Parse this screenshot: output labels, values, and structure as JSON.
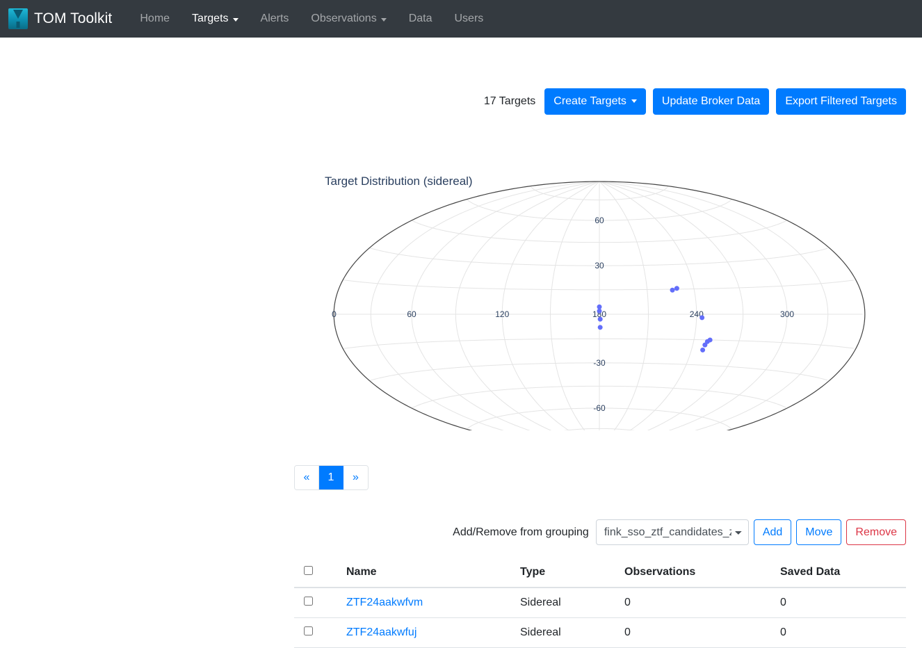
{
  "navbar": {
    "brand": "TOM Toolkit",
    "logo_icon": "tom-toolkit-logo-icon",
    "items": [
      {
        "label": "Home",
        "active": false,
        "caret": false
      },
      {
        "label": "Targets",
        "active": true,
        "caret": true
      },
      {
        "label": "Alerts",
        "active": false,
        "caret": false
      },
      {
        "label": "Observations",
        "active": false,
        "caret": true
      },
      {
        "label": "Data",
        "active": false,
        "caret": false
      },
      {
        "label": "Users",
        "active": false,
        "caret": false
      }
    ],
    "bg_color": "#343a40"
  },
  "actionbar": {
    "targets_count": "17 Targets",
    "create_targets": "Create Targets",
    "update_broker_data": "Update Broker Data",
    "export_filtered_targets": "Export Filtered Targets",
    "primary_color": "#007bff"
  },
  "chart_data": {
    "type": "scatter",
    "projection": "aitoff",
    "title": "Target Distribution (sidereal)",
    "xlabel": "",
    "ylabel": "",
    "xlim": [
      0,
      360
    ],
    "ylim": [
      -90,
      90
    ],
    "grid": true,
    "legend": "none",
    "marker_color": "#636efa",
    "marker_size": 6,
    "xticks": [
      0,
      60,
      120,
      180,
      240,
      300
    ],
    "yticks": [
      -60,
      -30,
      30,
      60
    ],
    "ra_grid_step": 30,
    "dec_grid_step": 15,
    "points": [
      {
        "ra": 180.0,
        "dec": 4.5
      },
      {
        "ra": 180.0,
        "dec": 2.0
      },
      {
        "ra": 180.5,
        "dec": -3.0
      },
      {
        "ra": 180.5,
        "dec": -8.0
      },
      {
        "ra": 226.0,
        "dec": 14.5
      },
      {
        "ra": 229.0,
        "dec": 15.5
      },
      {
        "ra": 243.5,
        "dec": -2.0
      },
      {
        "ra": 249.0,
        "dec": -16.0
      },
      {
        "ra": 250.5,
        "dec": -15.0
      },
      {
        "ra": 248.0,
        "dec": -18.0
      },
      {
        "ra": 247.5,
        "dec": -21.0
      }
    ]
  },
  "pagination": {
    "prev": "«",
    "next": "»",
    "pages": [
      "1"
    ],
    "current": "1"
  },
  "grouping": {
    "label": "Add/Remove from grouping",
    "selected": "fink_sso_ztf_candidates_z",
    "options": [
      "fink_sso_ztf_candidates_z"
    ],
    "add": "Add",
    "move": "Move",
    "remove": "Remove"
  },
  "table": {
    "columns": [
      "Name",
      "Type",
      "Observations",
      "Saved Data"
    ],
    "rows": [
      {
        "name": "ZTF24aakwfvm",
        "type": "Sidereal",
        "observations": "0",
        "saved_data": "0"
      },
      {
        "name": "ZTF24aakwfuj",
        "type": "Sidereal",
        "observations": "0",
        "saved_data": "0"
      }
    ]
  }
}
